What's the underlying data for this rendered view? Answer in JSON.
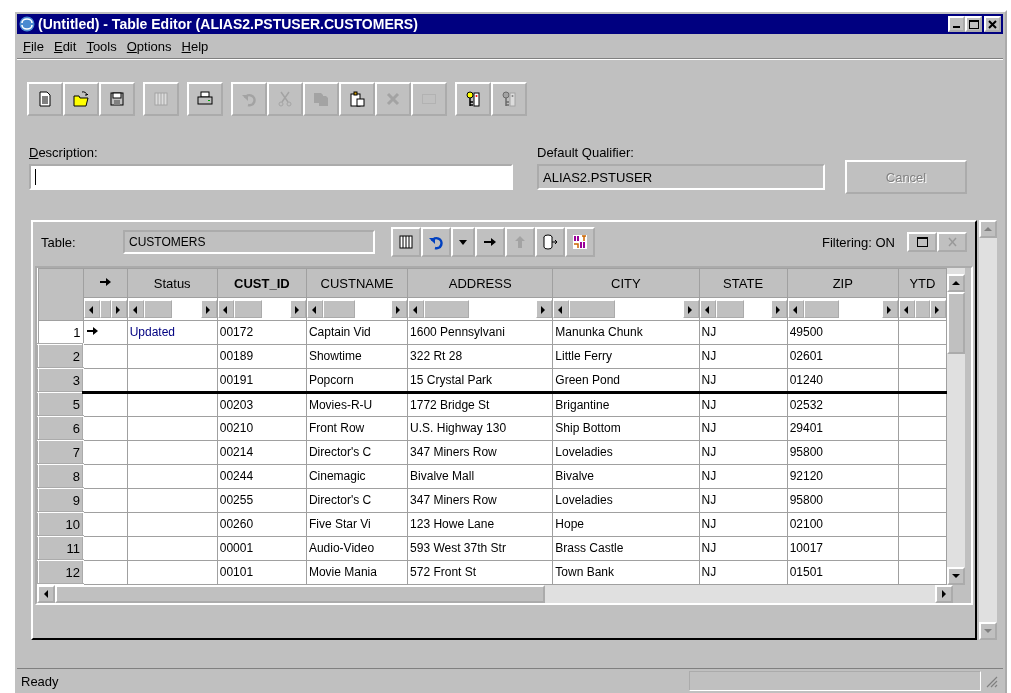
{
  "window": {
    "title": "(Untitled) - Table Editor (ALIAS2.PSTUSER.CUSTOMERS)"
  },
  "menu": [
    {
      "label": "File"
    },
    {
      "label": "Edit"
    },
    {
      "label": "Tools"
    },
    {
      "label": "Options"
    },
    {
      "label": "Help"
    }
  ],
  "toolbar": [
    [
      {
        "kind": "new",
        "disabled": false
      },
      {
        "kind": "open",
        "disabled": false
      },
      {
        "kind": "save",
        "disabled": false
      }
    ],
    [
      {
        "kind": "columns",
        "disabled": true
      }
    ],
    [
      {
        "kind": "print",
        "disabled": false
      }
    ],
    [
      {
        "kind": "undo",
        "disabled": true
      },
      {
        "kind": "cut",
        "disabled": true
      },
      {
        "kind": "copy",
        "disabled": true
      },
      {
        "kind": "paste",
        "disabled": false
      },
      {
        "kind": "delete",
        "disabled": true
      },
      {
        "kind": "select",
        "disabled": true
      }
    ],
    [
      {
        "kind": "key",
        "disabled": false
      },
      {
        "kind": "key",
        "disabled": true
      }
    ]
  ],
  "description": {
    "label": "Description:"
  },
  "qualifier": {
    "label": "Default Qualifier:",
    "value": "ALIAS2.PSTUSER"
  },
  "cancel": {
    "label": "Cancel",
    "disabled": true
  },
  "table_bar": {
    "label": "Table:",
    "value": "CUSTOMERS",
    "tools": [
      {
        "kind": "columns",
        "disabled": false
      },
      {
        "kind": "undo",
        "disabled": false
      },
      {
        "kind": "dropdown",
        "disabled": false
      },
      {
        "kind": "right",
        "disabled": false
      },
      {
        "kind": "up",
        "disabled": true
      },
      {
        "kind": "export",
        "disabled": false
      },
      {
        "kind": "sort",
        "disabled": false
      }
    ],
    "filtering": "Filtering: ON",
    "restore_disabled": false,
    "close_disabled": true
  },
  "columns": [
    {
      "label": "Status",
      "primary_key": false
    },
    {
      "label": "CUST_ID",
      "primary_key": true
    },
    {
      "label": "CUSTNAME",
      "primary_key": false
    },
    {
      "label": "ADDRESS",
      "primary_key": false
    },
    {
      "label": "CITY",
      "primary_key": false
    },
    {
      "label": "STATE",
      "primary_key": false
    },
    {
      "label": "ZIP",
      "primary_key": false
    },
    {
      "label": "YTD",
      "primary_key": false
    }
  ],
  "rows": [
    {
      "num": "1",
      "current": true,
      "split_after": false,
      "status": "Updated",
      "cells": [
        "00172",
        "Captain Vid",
        "1600 Pennsylvani",
        "Manunka Chunk",
        "NJ",
        "49500"
      ]
    },
    {
      "num": "2",
      "current": false,
      "split_after": false,
      "cells": [
        "00189",
        "Showtime",
        "322 Rt 28",
        "Little Ferry",
        "NJ",
        "02601"
      ]
    },
    {
      "num": "3",
      "current": false,
      "split_after": true,
      "cells": [
        "00191",
        "Popcorn",
        "15 Crystal Park",
        "Green Pond",
        "NJ",
        "01240"
      ]
    },
    {
      "num": "5",
      "current": false,
      "split_after": false,
      "cells": [
        "00203",
        "Movies-R-U",
        "1772 Bridge St",
        "Brigantine",
        "NJ",
        "02532"
      ]
    },
    {
      "num": "6",
      "current": false,
      "split_after": false,
      "cells": [
        "00210",
        "Front Row",
        "U.S. Highway 130",
        "Ship Bottom",
        "NJ",
        "29401"
      ]
    },
    {
      "num": "7",
      "current": false,
      "split_after": false,
      "cells": [
        "00214",
        "Director's C",
        "347 Miners Row",
        "Loveladies",
        "NJ",
        "95800"
      ]
    },
    {
      "num": "8",
      "current": false,
      "split_after": false,
      "cells": [
        "00244",
        "Cinemagic",
        "Bivalve Mall",
        "Bivalve",
        "NJ",
        "92120"
      ]
    },
    {
      "num": "9",
      "current": false,
      "split_after": false,
      "cells": [
        "00255",
        "Director's C",
        "347 Miners Row",
        "Loveladies",
        "NJ",
        "95800"
      ]
    },
    {
      "num": "10",
      "current": false,
      "split_after": false,
      "cells": [
        "00260",
        "Five Star Vi",
        "123 Howe Lane",
        "Hope",
        "NJ",
        "02100"
      ]
    },
    {
      "num": "11",
      "current": false,
      "split_after": false,
      "cells": [
        "00001",
        "Audio-Video",
        "593 West 37th Str",
        "Brass Castle",
        "NJ",
        "10017"
      ]
    },
    {
      "num": "12",
      "current": false,
      "split_after": false,
      "cells": [
        "00101",
        "Movie Mania",
        "572 Front St",
        "Town Bank",
        "NJ",
        "01501"
      ]
    }
  ],
  "status_bar": {
    "text": "Ready"
  }
}
